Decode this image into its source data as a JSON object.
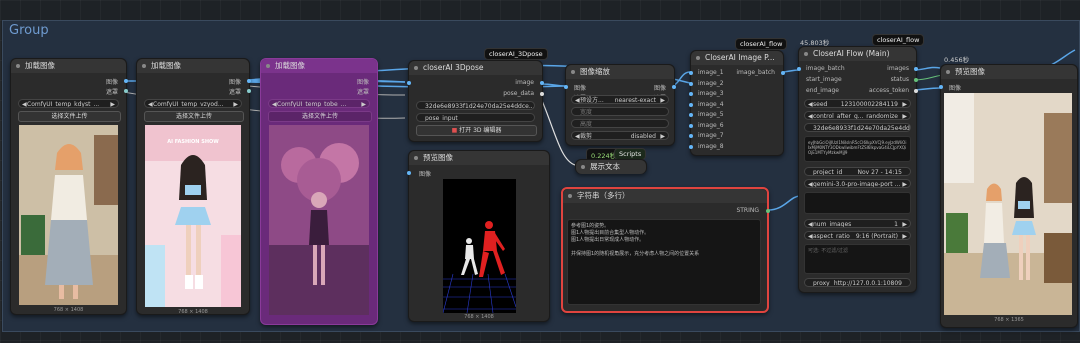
{
  "group": {
    "title": "Group"
  },
  "timers": {
    "t1": "0.224秒",
    "t2": "45.803秒",
    "t3": "0.456秒"
  },
  "load1": {
    "title": "加载图像",
    "out_image": "图像",
    "out_mask": "遮罩",
    "file": "ComfyUI_temp_kdyst_...",
    "upload": "选择文件上传",
    "dim": "768 × 1408"
  },
  "load2": {
    "title": "加载图像",
    "out_image": "图像",
    "out_mask": "遮罩",
    "file": "ComfyUI_temp_vzyod...",
    "upload": "选择文件上传",
    "poster_top": "AI FASHION SHOW",
    "dim": "768 × 1408"
  },
  "load3": {
    "title": "加载图像",
    "out_image": "图像",
    "out_mask": "遮罩",
    "file": "ComfyUI_temp_tobe_...",
    "upload": "选择文件上传"
  },
  "pose3d": {
    "badge": "closerAI_3Dpose",
    "title": "closerAI 3Dpose",
    "out_image": "image",
    "out_pose": "pose_data",
    "seed": "32de6e8933f1d24e70da25e4ddce...",
    "pose_input": "pose_input",
    "open_editor": "打开 3D 编辑器"
  },
  "preview1": {
    "title": "预览图像",
    "in_image": "图像",
    "dim": "768 × 1408"
  },
  "resize": {
    "title": "图像缩放",
    "in_image": "图像",
    "out_image": "图像",
    "in_mask": "遮罩",
    "out_mask": "遮罩",
    "preset_label": "预设方...",
    "preset_value": "nearest-exact",
    "w": "宽度",
    "h": "高度",
    "crop_label": "裁剪",
    "crop_value": "disabled"
  },
  "scripts": {
    "badge": "Scripts",
    "title": "展示文本"
  },
  "imgpack": {
    "badge": "closerAI_flow",
    "title": "CloserAI Image P...",
    "out": "image_batch",
    "inputs": [
      "image_1",
      "image_2",
      "image_3",
      "image_4",
      "image_5",
      "image_6",
      "image_7",
      "image_8"
    ]
  },
  "flow": {
    "badge": "closerAI_flow",
    "title": "CloserAI Flow (Main)",
    "in1": "image_batch",
    "in2": "start_image",
    "in3": "end_image",
    "out1": "images",
    "out2": "status",
    "out3": "access_token",
    "seed_label": "seed",
    "seed_value": "123100002284119",
    "cag_label": "control_after_g...",
    "cag_value": "randomize",
    "token": "32de6e8933f1d24e70da25e4ddce",
    "hash_text": "eyJhbGciOiJIUzI1NiIsInR5cCI6IkpXVCJ9.eyJzdWIiOiIxMjM0NTY3ODkwIiwibmFtZSI6IkpvaG4iLCJpYXQiOjE1MTYyMzkwMjJ9",
    "project_label": "project_id",
    "project_value": "Nov 27 - 14:15",
    "model_value": "gemini-3.0-pro-image-port ...",
    "num_label": "num_images",
    "num_value": "1",
    "ratio_label": "aspect_ratio",
    "ratio_value": "9:16 (Portrait)",
    "neg_placeholder": "可选: 不过滤/过滤",
    "proxy_label": "proxy",
    "proxy_value": "http://127.0.0.1:10809"
  },
  "stringnode": {
    "title": "字符串（多行）",
    "out": "STRING",
    "text": "参考图1的姿势。\n图1人物提出目前合集型人物动作。\n图1人物提出日常现成人物动作。\n\n并保持图1的随机视角展示，充分考虑人物之间的位置关系"
  },
  "preview2": {
    "title": "预览图像",
    "in_image": "图像",
    "dim": "768 × 1365"
  },
  "colors": {
    "accent": "#e0443f",
    "pose": "#e02020",
    "wire": "#5aa6e8",
    "purple": "#7a2a8c"
  }
}
